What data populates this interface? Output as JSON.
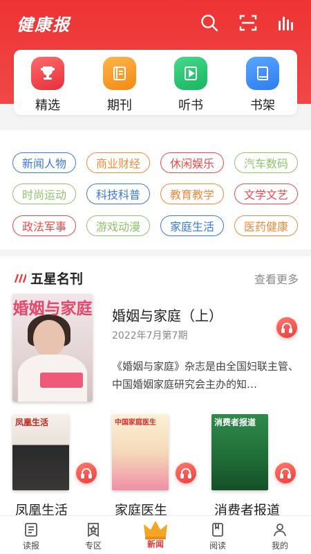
{
  "header": {
    "brand": "健康报",
    "bg_color": "#ee3333",
    "icons": [
      "search-icon",
      "scan-icon",
      "audio-bars-icon"
    ]
  },
  "features": [
    {
      "label": "精选",
      "icon": "trophy-icon",
      "color": "#e62f3a"
    },
    {
      "label": "期刊",
      "icon": "journal-icon",
      "color": "#f28a12"
    },
    {
      "label": "听书",
      "icon": "play-icon",
      "color": "#18b561"
    },
    {
      "label": "书架",
      "icon": "bookshelf-icon",
      "color": "#2d7cf0"
    }
  ],
  "categories": [
    {
      "label": "新闻人物",
      "color": "#3b78e7"
    },
    {
      "label": "商业财经",
      "color": "#f08a3c"
    },
    {
      "label": "休闲娱乐",
      "color": "#ee4a4a"
    },
    {
      "label": "汽车数码",
      "color": "#8fc46a"
    },
    {
      "label": "时尚运动",
      "color": "#8fc46a"
    },
    {
      "label": "科技科普",
      "color": "#3b78e7"
    },
    {
      "label": "教育教学",
      "color": "#f08a3c"
    },
    {
      "label": "文学文艺",
      "color": "#ee4a4a"
    },
    {
      "label": "政法军事",
      "color": "#ee4a4a"
    },
    {
      "label": "游戏动漫",
      "color": "#8fc46a"
    },
    {
      "label": "家庭生活",
      "color": "#3b78e7"
    },
    {
      "label": "医药健康",
      "color": "#f08a3c"
    }
  ],
  "five_star": {
    "title": "五星名刊",
    "more": "查看更多",
    "featured": {
      "cover_title": "婚姻与家庭",
      "title": "婚姻与家庭（上）",
      "date": "2022年7月第7期",
      "description": "《婚姻与家庭》杂志是由全国妇联主管、中国婚姻家庭研究会主办的知…"
    },
    "items": [
      {
        "name": "凤凰生活",
        "cover_title": "凤凰生活"
      },
      {
        "name": "家庭医生",
        "cover_title": "中国家庭医生"
      },
      {
        "name": "消费者报道",
        "cover_title": "消费者报道"
      }
    ]
  },
  "nav": [
    {
      "label": "读报",
      "icon": "newspaper-icon"
    },
    {
      "label": "专区",
      "icon": "star-badge-icon"
    },
    {
      "label": "新闻",
      "icon": "crown-icon"
    },
    {
      "label": "阅读",
      "icon": "book-icon"
    },
    {
      "label": "我的",
      "icon": "person-icon"
    }
  ]
}
